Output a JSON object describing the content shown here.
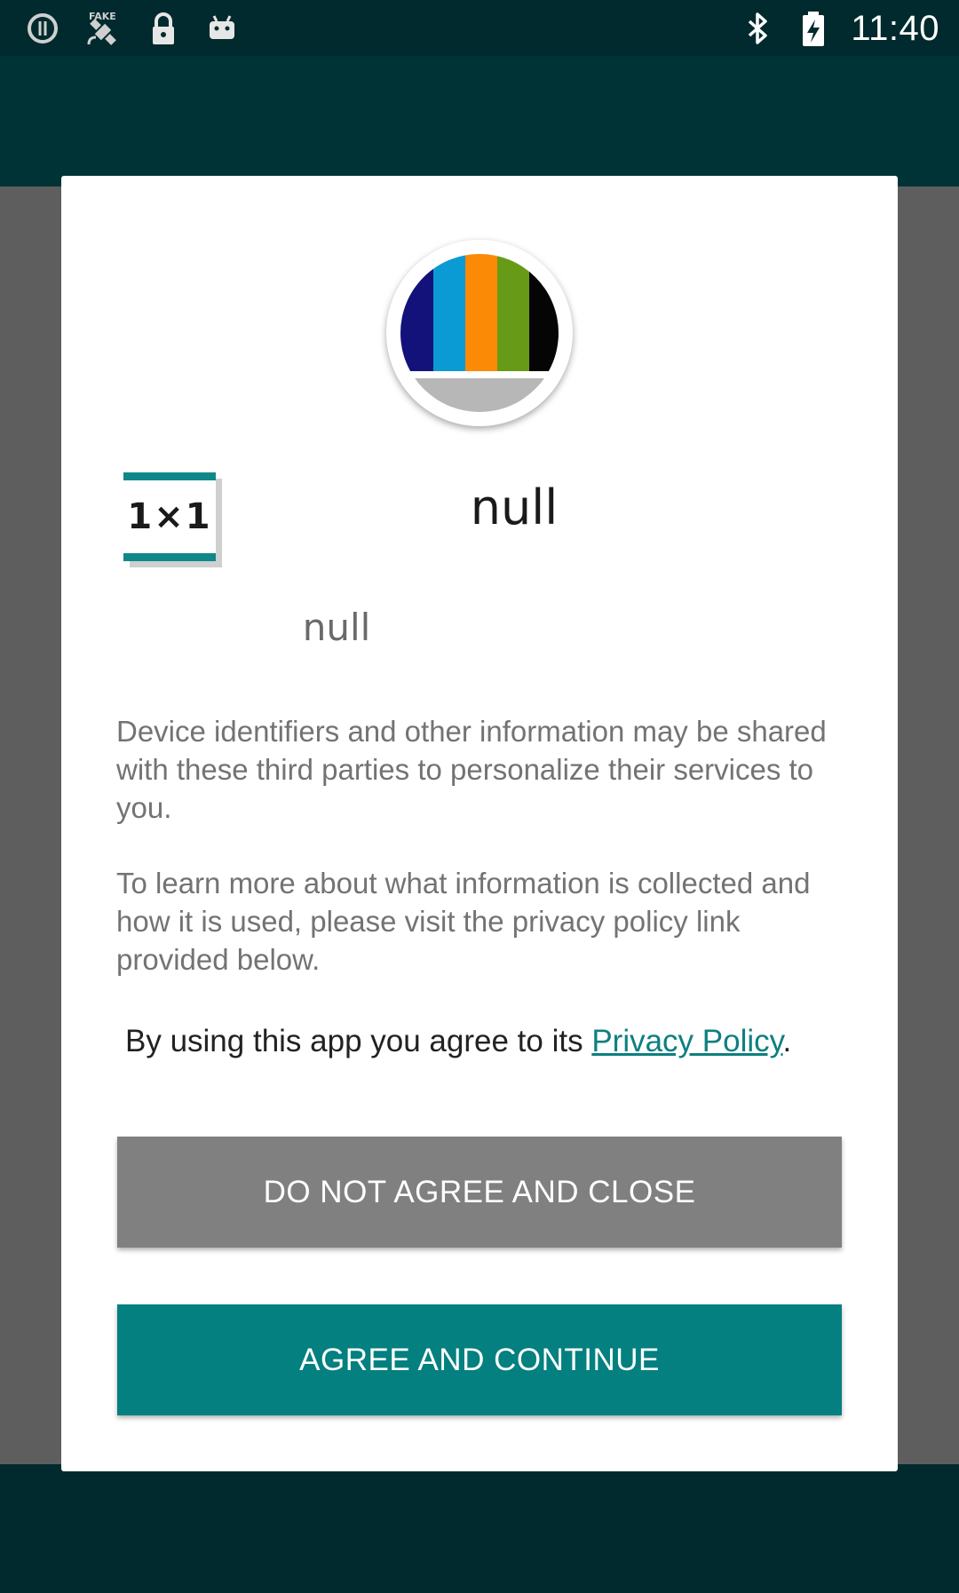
{
  "status_bar": {
    "time": "11:40",
    "left_icons": [
      "info-icon",
      "fake-gps-satellite-icon",
      "lock-icon",
      "android-icon"
    ],
    "right_icons": [
      "bluetooth-icon",
      "battery-charging-icon"
    ]
  },
  "dialog": {
    "logo_icon": "tv-stripes-logo-icon",
    "badge_text": "1×1",
    "app_name": "null",
    "app_subtitle": "null",
    "paragraph1": " Device identifiers and other information may be shared with these third parties to personalize their services to you.",
    "paragraph2": " To learn more about what information is collected and how it is used, please visit the privacy policy link provided below.",
    "agree_prefix": "By using this app you agree to its ",
    "privacy_link": "Privacy Policy",
    "agree_suffix": ".",
    "decline_button": "DO NOT AGREE AND CLOSE",
    "agree_button": "AGREE AND CONTINUE"
  },
  "colors": {
    "accent": "#03807f",
    "decline_button": "#808080",
    "status_bar": "#002a2d",
    "link": "#0e7f80"
  }
}
